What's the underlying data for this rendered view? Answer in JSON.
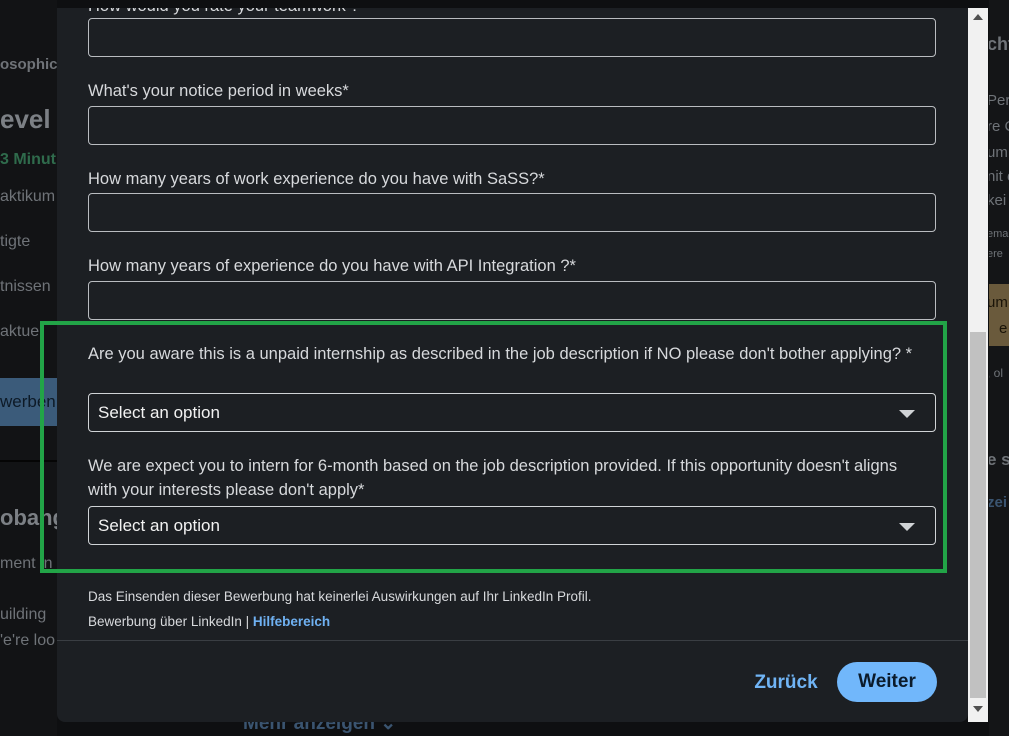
{
  "background": {
    "left_fragments": [
      "osophic",
      "evel",
      "3 Minut",
      "aktikum",
      "tigte",
      "tnissen",
      "aktuel",
      "werben",
      "obang",
      "ment in",
      "uilding",
      "'e're loo"
    ],
    "right_fragments": [
      "cht",
      "Pers",
      "re C",
      "um",
      "nit e",
      "kei",
      "ema",
      "ere",
      "um",
      "e",
      ", ol",
      "e s",
      "zei"
    ],
    "bottom_link": "Mehr anzeigen"
  },
  "form": {
    "cut_label": "How would you rate your teamwork ?",
    "notice_label": "What's your notice period in weeks*",
    "sass_label": "How many years of work experience do you have with SaSS?*",
    "api_label": "How many years of experience do you have with API Integration ?*",
    "unpaid_label": "Are you aware this is a unpaid internship as described in the job description if NO please don't bother applying? *",
    "unpaid_value": "Select an option",
    "intern_label": "We are expect you to intern for 6-month based on the job description provided. If this opportunity doesn't aligns with your interests please don't apply*",
    "intern_value": "Select an option"
  },
  "notes": {
    "privacy": "Das Einsenden dieser Bewerbung hat keinerlei Auswirkungen auf Ihr LinkedIn Profil.",
    "via": "Bewerbung über LinkedIn |",
    "help_link": "Hilfebereich"
  },
  "footer": {
    "back_label": "Zurück",
    "next_label": "Weiter"
  },
  "colors": {
    "accent": "#71b7fb",
    "highlight": "#22a447",
    "modal_bg": "#1c1f23"
  },
  "icons": [
    "chevron-down-icon",
    "scroll-up-arrow-icon",
    "scroll-down-arrow-icon"
  ]
}
